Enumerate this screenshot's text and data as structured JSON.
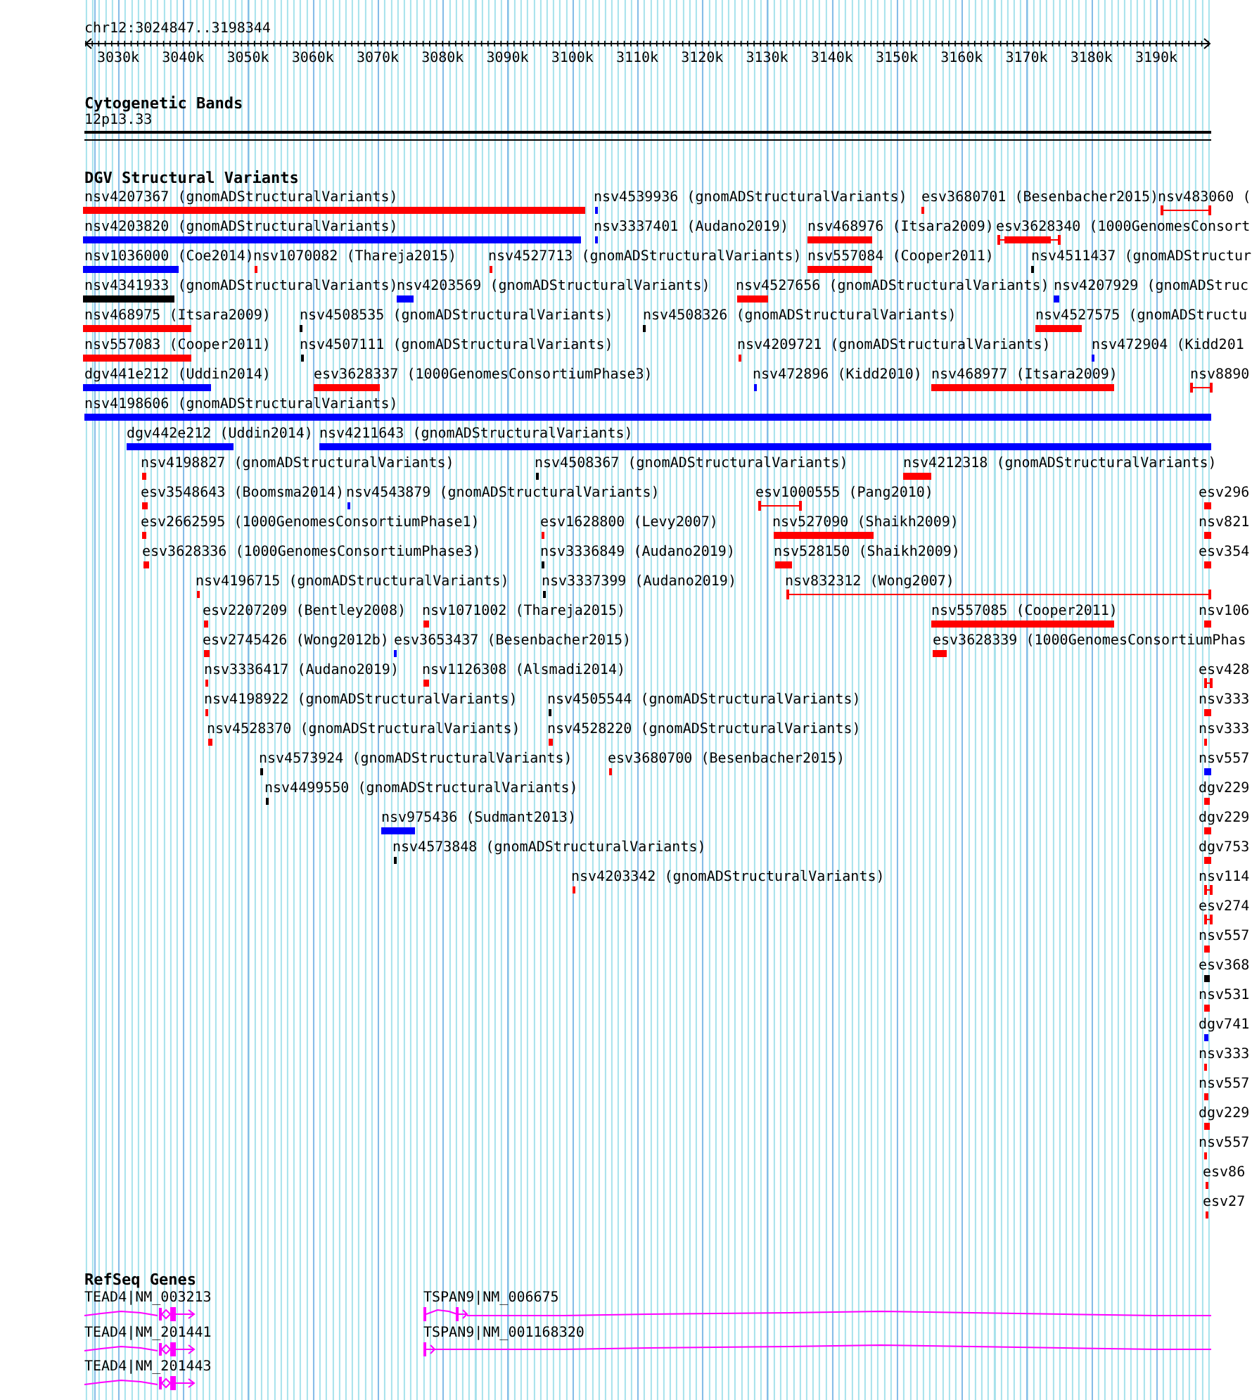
{
  "location": "chr12:3024847..3198344",
  "ruler": {
    "ticks": [
      "3030k",
      "3040k",
      "3050k",
      "3060k",
      "3070k",
      "3080k",
      "3090k",
      "3100k",
      "3110k",
      "3120k",
      "3130k",
      "3140k",
      "3150k",
      "3160k",
      "3170k",
      "3180k",
      "3190k"
    ]
  },
  "cytogenetic_bands": {
    "title": "Cytogenetic Bands",
    "band": "12p13.33"
  },
  "dgv_structural_variants": {
    "title": "DGV Structural Variants",
    "rows": [
      {
        "features": [
          {
            "label": "nsv4207367 (gnomADStructuralVariants)",
            "color": "#ff0000",
            "kind": "block"
          },
          {
            "label": "nsv4539936 (gnomADStructuralVariants)",
            "color": "#0000ff",
            "kind": "block"
          },
          {
            "label": "esv3680701 (Besenbacher2015)",
            "color": "#ff0000",
            "kind": "block"
          },
          {
            "label": "nsv483060 (",
            "color": "#ff0000",
            "kind": "span"
          }
        ]
      },
      {
        "features": [
          {
            "label": "nsv4203820 (gnomADStructuralVariants)",
            "color": "#0000ff",
            "kind": "block"
          },
          {
            "label": "nsv3337401 (Audano2019)",
            "color": "#0000ff",
            "kind": "block"
          },
          {
            "label": "nsv468976 (Itsara2009)",
            "color": "#ff0000",
            "kind": "block"
          },
          {
            "label": "esv3628340 (1000GenomesConsort",
            "color": "#ff0000",
            "kind": "capped"
          }
        ]
      },
      {
        "features": [
          {
            "label": "nsv1036000 (Coe2014)",
            "color": "#0000ff",
            "kind": "block"
          },
          {
            "label": "nsv1070082 (Thareja2015)",
            "color": "#ff0000",
            "kind": "block"
          },
          {
            "label": "nsv4527713 (gnomADStructuralVariants)",
            "color": "#ff0000",
            "kind": "block"
          },
          {
            "label": "nsv557084 (Cooper2011)",
            "color": "#ff0000",
            "kind": "block"
          },
          {
            "label": "nsv4511437 (gnomADStructur",
            "color": "#000000",
            "kind": "block"
          }
        ]
      },
      {
        "features": [
          {
            "label": "nsv4341933 (gnomADStructuralVariants)",
            "color": "#000000",
            "kind": "block"
          },
          {
            "label": "nsv4203569 (gnomADStructuralVariants)",
            "color": "#0000ff",
            "kind": "block"
          },
          {
            "label": "nsv4527656 (gnomADStructuralVariants)",
            "color": "#ff0000",
            "kind": "block"
          },
          {
            "label": "nsv4207929 (gnomADStruc",
            "color": "#0000ff",
            "kind": "block"
          }
        ]
      },
      {
        "features": [
          {
            "label": "nsv468975 (Itsara2009)",
            "color": "#ff0000",
            "kind": "block"
          },
          {
            "label": "nsv4508535 (gnomADStructuralVariants)",
            "color": "#000000",
            "kind": "block"
          },
          {
            "label": "nsv4508326 (gnomADStructuralVariants)",
            "color": "#000000",
            "kind": "block"
          },
          {
            "label": "nsv4527575 (gnomADStructu",
            "color": "#ff0000",
            "kind": "block"
          }
        ]
      },
      {
        "features": [
          {
            "label": "nsv557083 (Cooper2011)",
            "color": "#ff0000",
            "kind": "block"
          },
          {
            "label": "nsv4507111 (gnomADStructuralVariants)",
            "color": "#000000",
            "kind": "block"
          },
          {
            "label": "nsv4209721 (gnomADStructuralVariants)",
            "color": "#ff0000",
            "kind": "block"
          },
          {
            "label": "nsv472904 (Kidd201",
            "color": "#0000ff",
            "kind": "block"
          }
        ]
      },
      {
        "features": [
          {
            "label": "dgv441e212 (Uddin2014)",
            "color": "#0000ff",
            "kind": "block"
          },
          {
            "label": "esv3628337 (1000GenomesConsortiumPhase3)",
            "color": "#ff0000",
            "kind": "block"
          },
          {
            "label": "nsv472896 (Kidd2010)",
            "color": "#0000ff",
            "kind": "block"
          },
          {
            "label": "nsv468977 (Itsara2009)",
            "color": "#ff0000",
            "kind": "block"
          },
          {
            "label": "nsv8890",
            "color": "#ff0000",
            "kind": "span"
          }
        ]
      },
      {
        "features": [
          {
            "label": "nsv4198606 (gnomADStructuralVariants)",
            "color": "#0000ff",
            "kind": "block"
          }
        ]
      },
      {
        "features": [
          {
            "label": "dgv442e212 (Uddin2014)",
            "color": "#0000ff",
            "kind": "block"
          },
          {
            "label": "nsv4211643 (gnomADStructuralVariants)",
            "color": "#0000ff",
            "kind": "block"
          }
        ]
      },
      {
        "features": [
          {
            "label": "nsv4198827 (gnomADStructuralVariants)",
            "color": "#ff0000",
            "kind": "block"
          },
          {
            "label": "nsv4508367 (gnomADStructuralVariants)",
            "color": "#000000",
            "kind": "block"
          },
          {
            "label": "nsv4212318 (gnomADStructuralVariants)",
            "color": "#ff0000",
            "kind": "block"
          }
        ]
      },
      {
        "features": [
          {
            "label": "esv3548643 (Boomsma2014)",
            "color": "#ff0000",
            "kind": "block"
          },
          {
            "label": "nsv4543879 (gnomADStructuralVariants)",
            "color": "#0000ff",
            "kind": "block"
          },
          {
            "label": "esv1000555 (Pang2010)",
            "color": "#ff0000",
            "kind": "span"
          },
          {
            "label": "esv296",
            "color": "#ff0000",
            "kind": "block"
          }
        ]
      },
      {
        "features": [
          {
            "label": "esv2662595 (1000GenomesConsortiumPhase1)",
            "color": "#ff0000",
            "kind": "block"
          },
          {
            "label": "esv1628800 (Levy2007)",
            "color": "#ff0000",
            "kind": "block"
          },
          {
            "label": "nsv527090 (Shaikh2009)",
            "color": "#ff0000",
            "kind": "block"
          },
          {
            "label": "nsv821",
            "color": "#ff0000",
            "kind": "block"
          }
        ]
      },
      {
        "features": [
          {
            "label": "esv3628336 (1000GenomesConsortiumPhase3)",
            "color": "#ff0000",
            "kind": "block"
          },
          {
            "label": "nsv3336849 (Audano2019)",
            "color": "#000000",
            "kind": "block"
          },
          {
            "label": "nsv528150 (Shaikh2009)",
            "color": "#ff0000",
            "kind": "block"
          },
          {
            "label": "esv354",
            "color": "#ff0000",
            "kind": "block"
          }
        ]
      },
      {
        "features": [
          {
            "label": "nsv4196715 (gnomADStructuralVariants)",
            "color": "#ff0000",
            "kind": "block"
          },
          {
            "label": "nsv3337399 (Audano2019)",
            "color": "#000000",
            "kind": "block"
          },
          {
            "label": "nsv832312 (Wong2007)",
            "color": "#ff0000",
            "kind": "span"
          }
        ]
      },
      {
        "features": [
          {
            "label": "esv2207209 (Bentley2008)",
            "color": "#ff0000",
            "kind": "block"
          },
          {
            "label": "nsv1071002 (Thareja2015)",
            "color": "#ff0000",
            "kind": "block"
          },
          {
            "label": "nsv557085 (Cooper2011)",
            "color": "#ff0000",
            "kind": "block"
          },
          {
            "label": "nsv106",
            "color": "#ff0000",
            "kind": "block"
          }
        ]
      },
      {
        "features": [
          {
            "label": "esv2745426 (Wong2012b)",
            "color": "#ff0000",
            "kind": "block"
          },
          {
            "label": "esv3653437 (Besenbacher2015)",
            "color": "#0000ff",
            "kind": "block"
          },
          {
            "label": "esv3628339 (1000GenomesConsortiumPhas",
            "color": "#ff0000",
            "kind": "block"
          }
        ]
      },
      {
        "features": [
          {
            "label": "nsv3336417 (Audano2019)",
            "color": "#ff0000",
            "kind": "block"
          },
          {
            "label": "nsv1126308 (Alsmadi2014)",
            "color": "#ff0000",
            "kind": "block"
          },
          {
            "label": "esv428",
            "color": "#ff0000",
            "kind": "span"
          }
        ]
      },
      {
        "features": [
          {
            "label": "nsv4198922 (gnomADStructuralVariants)",
            "color": "#ff0000",
            "kind": "block"
          },
          {
            "label": "nsv4505544 (gnomADStructuralVariants)",
            "color": "#000000",
            "kind": "block"
          },
          {
            "label": "nsv333",
            "color": "#ff0000",
            "kind": "block"
          }
        ]
      },
      {
        "features": [
          {
            "label": "nsv4528370 (gnomADStructuralVariants)",
            "color": "#ff0000",
            "kind": "block"
          },
          {
            "label": "nsv4528220 (gnomADStructuralVariants)",
            "color": "#ff0000",
            "kind": "block"
          },
          {
            "label": "nsv333",
            "color": "#ff0000",
            "kind": "block"
          }
        ]
      },
      {
        "features": [
          {
            "label": "nsv4573924 (gnomADStructuralVariants)",
            "color": "#000000",
            "kind": "block"
          },
          {
            "label": "esv3680700 (Besenbacher2015)",
            "color": "#ff0000",
            "kind": "block"
          },
          {
            "label": "nsv557",
            "color": "#0000ff",
            "kind": "block"
          }
        ]
      },
      {
        "features": [
          {
            "label": "nsv4499550 (gnomADStructuralVariants)",
            "color": "#000000",
            "kind": "block"
          },
          {
            "label": "dgv229",
            "color": "#ff0000",
            "kind": "block"
          }
        ]
      },
      {
        "features": [
          {
            "label": "nsv975436 (Sudmant2013)",
            "color": "#0000ff",
            "kind": "block"
          },
          {
            "label": "dgv229",
            "color": "#ff0000",
            "kind": "block"
          }
        ]
      },
      {
        "features": [
          {
            "label": "nsv4573848 (gnomADStructuralVariants)",
            "color": "#000000",
            "kind": "block"
          },
          {
            "label": "dgv753",
            "color": "#ff0000",
            "kind": "block"
          }
        ]
      },
      {
        "features": [
          {
            "label": "nsv4203342 (gnomADStructuralVariants)",
            "color": "#ff0000",
            "kind": "block"
          },
          {
            "label": "nsv114",
            "color": "#ff0000",
            "kind": "span"
          }
        ]
      },
      {
        "features": [
          {
            "label": "esv274",
            "color": "#ff0000",
            "kind": "span"
          }
        ]
      },
      {
        "features": [
          {
            "label": "nsv557",
            "color": "#ff0000",
            "kind": "block"
          }
        ]
      },
      {
        "features": [
          {
            "label": "esv368",
            "color": "#000000",
            "kind": "block"
          }
        ]
      },
      {
        "features": [
          {
            "label": "nsv531",
            "color": "#ff0000",
            "kind": "block"
          }
        ]
      },
      {
        "features": [
          {
            "label": "dgv741",
            "color": "#0000ff",
            "kind": "block"
          }
        ]
      },
      {
        "features": [
          {
            "label": "nsv333",
            "color": "#ff0000",
            "kind": "block"
          }
        ]
      },
      {
        "features": [
          {
            "label": "nsv557",
            "color": "#ff0000",
            "kind": "block"
          }
        ]
      },
      {
        "features": [
          {
            "label": "dgv229",
            "color": "#ff0000",
            "kind": "block"
          }
        ]
      },
      {
        "features": [
          {
            "label": "nsv557",
            "color": "#ff0000",
            "kind": "block"
          }
        ]
      },
      {
        "features": [
          {
            "label": "esv86",
            "color": "#ff0000",
            "kind": "block"
          }
        ]
      },
      {
        "features": [
          {
            "label": "esv27",
            "color": "#ff0000",
            "kind": "block"
          }
        ]
      }
    ]
  },
  "refseq_genes": {
    "title": "RefSeq Genes",
    "rows": [
      [
        {
          "label": "TEAD4|NM_003213"
        },
        {
          "label": "TSPAN9|NM_006675"
        }
      ],
      [
        {
          "label": "TEAD4|NM_201441"
        },
        {
          "label": "TSPAN9|NM_001168320"
        }
      ],
      [
        {
          "label": "TEAD4|NM_201443"
        }
      ]
    ]
  }
}
